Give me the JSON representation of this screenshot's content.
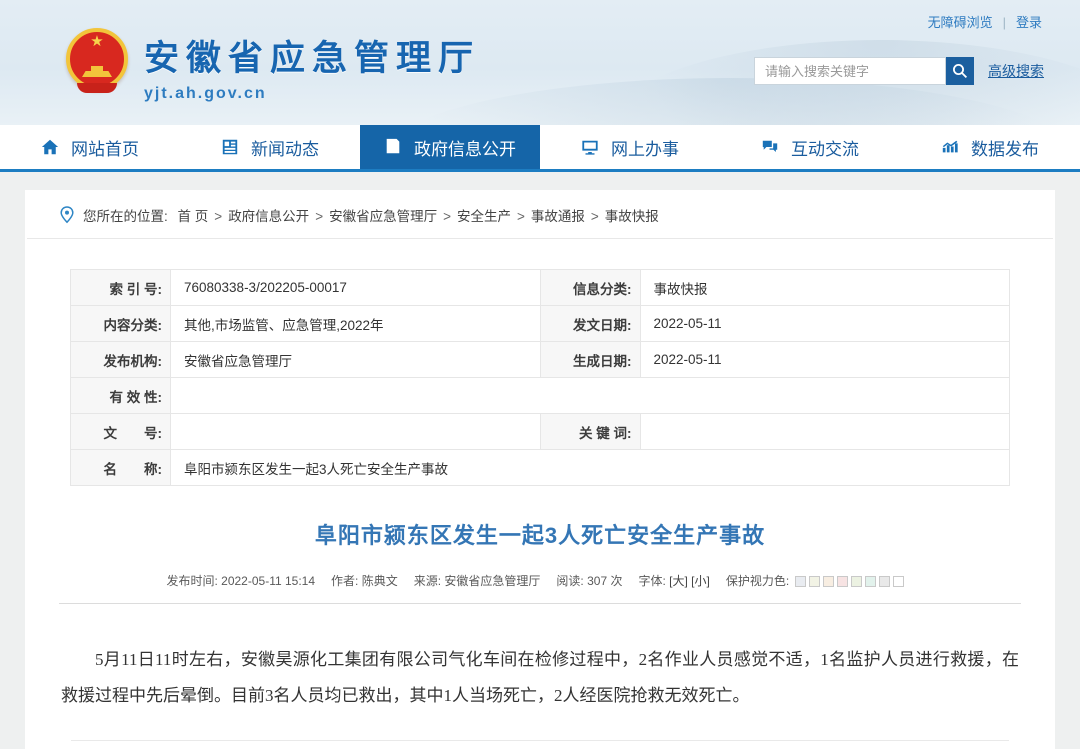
{
  "top_bar": {
    "accessibility_label": "无障碍浏览",
    "separator": "|",
    "login_label": "登录"
  },
  "header": {
    "site_name": "安徽省应急管理厅",
    "site_url": "yjt.ah.gov.cn",
    "search_placeholder": "请输入搜索关键字",
    "advanced_search_label": "高级搜索",
    "search_button_color": "#1b5f9f"
  },
  "nav": {
    "active_index": 2,
    "items": [
      {
        "label": "网站首页",
        "icon": "home-icon"
      },
      {
        "label": "新闻动态",
        "icon": "news-icon"
      },
      {
        "label": "政府信息公开",
        "icon": "document-icon"
      },
      {
        "label": "网上办事",
        "icon": "monitor-icon"
      },
      {
        "label": "互动交流",
        "icon": "chat-icon"
      },
      {
        "label": "数据发布",
        "icon": "chart-icon"
      }
    ]
  },
  "breadcrumb": {
    "prefix": "您所在的位置:",
    "items": [
      "首 页",
      "政府信息公开",
      "安徽省应急管理厅",
      "安全生产",
      "事故通报",
      "事故快报"
    ],
    "separator": ">"
  },
  "info_table": {
    "rows": [
      {
        "label1": "索 引 号:",
        "value1": "76080338-3/202205-00017",
        "label2": "信息分类:",
        "value2": "事故快报"
      },
      {
        "label1": "内容分类:",
        "value1": "其他,市场监管、应急管理,2022年",
        "label2": "发文日期:",
        "value2": "2022-05-11"
      },
      {
        "label1": "发布机构:",
        "value1": "安徽省应急管理厅",
        "label2": "生成日期:",
        "value2": "2022-05-11"
      },
      {
        "label1": "有 效 性:",
        "value1": ""
      },
      {
        "label1": "文　　号:",
        "value1": "",
        "label2": "关 键 词:",
        "value2": ""
      },
      {
        "label1": "名　　称:",
        "value1": "阜阳市颍东区发生一起3人死亡安全生产事故"
      }
    ]
  },
  "article": {
    "title": "阜阳市颍东区发生一起3人死亡安全生产事故",
    "meta": {
      "published_label": "发布时间:",
      "published_value": "2022-05-11 15:14",
      "author_label": "作者:",
      "author_value": "陈典文",
      "source_label": "来源:",
      "source_value": "安徽省应急管理厅",
      "views_label": "阅读:",
      "views_value": "307 次",
      "font_label": "字体:",
      "font_large": "[大]",
      "font_small": "[小]",
      "eye_protect_label": "保护视力色:"
    },
    "body": "5月11日11时左右，安徽昊源化工集团有限公司气化车间在检修过程中，2名作业人员感觉不适，1名监护人员进行救援，在救援过程中先后晕倒。目前3名人员均已救出，其中1人当场死亡，2人经医院抢救无效死亡。"
  },
  "eye_protection": {
    "colors": [
      "#e9ecf1",
      "#f2f3e5",
      "#f8eee2",
      "#f7e3e3",
      "#ecf2e2",
      "#e2f2ec",
      "#e9e9e9",
      "#ffffff"
    ]
  },
  "colors": {
    "accent_blue": "#1565a8",
    "nav_text": "#1a5c9e",
    "title_blue": "#3476b5",
    "link_blue": "#2f7cc1"
  }
}
